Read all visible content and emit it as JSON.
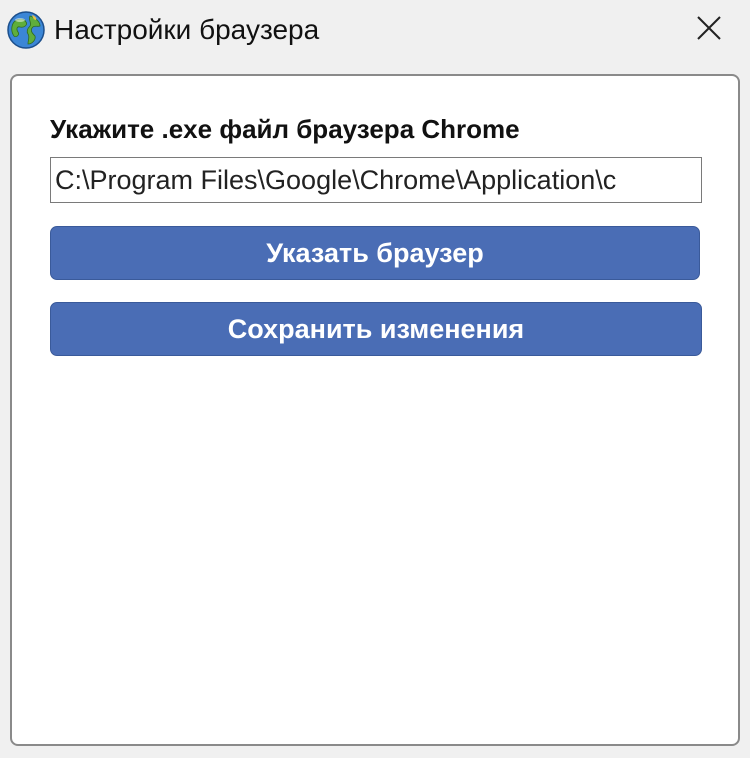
{
  "window": {
    "title": "Настройки браузера",
    "app_icon": "globe-icon",
    "close_icon": "close-icon"
  },
  "form": {
    "label": "Укажите .exe файл браузера Chrome",
    "path_value": "C:\\Program Files\\Google\\Chrome\\Application\\c",
    "choose_button_label": "Указать браузер",
    "save_button_label": "Сохранить изменения"
  },
  "colors": {
    "button_bg": "#4a6db5",
    "button_text": "#ffffff",
    "window_bg": "#f0f0f0",
    "panel_bg": "#ffffff"
  }
}
